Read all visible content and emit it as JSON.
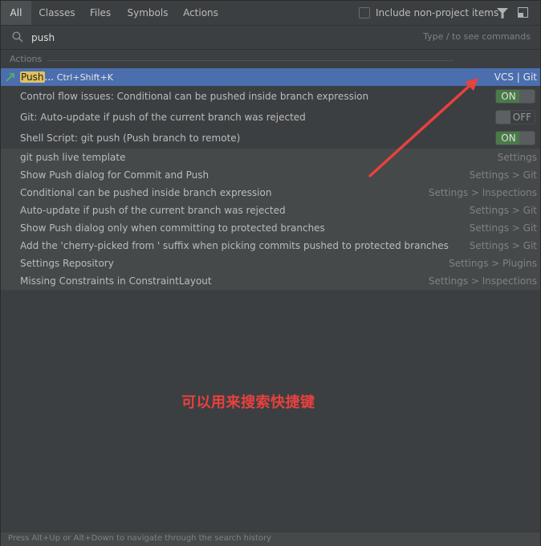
{
  "tabs": [
    {
      "label": "All",
      "active": true
    },
    {
      "label": "Classes",
      "active": false
    },
    {
      "label": "Files",
      "active": false
    },
    {
      "label": "Symbols",
      "active": false
    },
    {
      "label": "Actions",
      "active": false
    }
  ],
  "include_non_project": {
    "label": "Include non-project items",
    "checked": false
  },
  "toolbar_icons": [
    "filter-icon",
    "preview-icon"
  ],
  "search": {
    "value": "push",
    "hint": "Type / to see commands",
    "icon": "search-icon"
  },
  "section": {
    "label": "Actions"
  },
  "results": [
    {
      "match": "Push",
      "rest": "...",
      "shortcut": "Ctrl+Shift+K",
      "location": "VCS | Git",
      "selected": true,
      "icon": "push-arrow-icon"
    },
    {
      "label": "Control flow issues: Conditional can be pushed inside branch expression",
      "toggle": "ON"
    },
    {
      "label": "Git: Auto-update if push of the current branch was rejected",
      "toggle": "OFF"
    },
    {
      "label": "Shell Script: git push (Push branch to remote)",
      "toggle": "ON"
    },
    {
      "label": "git push live template",
      "location": "Settings"
    },
    {
      "label": "Show Push dialog for Commit and Push",
      "location": "Settings > Git"
    },
    {
      "label": "Conditional can be pushed inside branch expression",
      "location": "Settings > Inspections"
    },
    {
      "label": "Auto-update if push of the current branch was rejected",
      "location": "Settings > Git"
    },
    {
      "label": "Show Push dialog only when committing to protected branches",
      "location": "Settings > Git"
    },
    {
      "label": "Add the 'cherry-picked from ' suffix when picking commits pushed to protected branches",
      "location": "Settings > Git"
    },
    {
      "label": "Settings Repository",
      "location": "Settings > Plugins"
    },
    {
      "label": "Missing Constraints in ConstraintLayout",
      "location": "Settings > Inspections"
    }
  ],
  "annotation": {
    "text": "可以用来搜索快捷键",
    "color": "#e8413e"
  },
  "footer": {
    "text": "Press Alt+Up or Alt+Down to navigate through the search history"
  },
  "colors": {
    "selection": "#4b6eaf",
    "background": "#3c3f41",
    "toggle_on": "#4a7a48",
    "highlight": "#e0c15f"
  }
}
